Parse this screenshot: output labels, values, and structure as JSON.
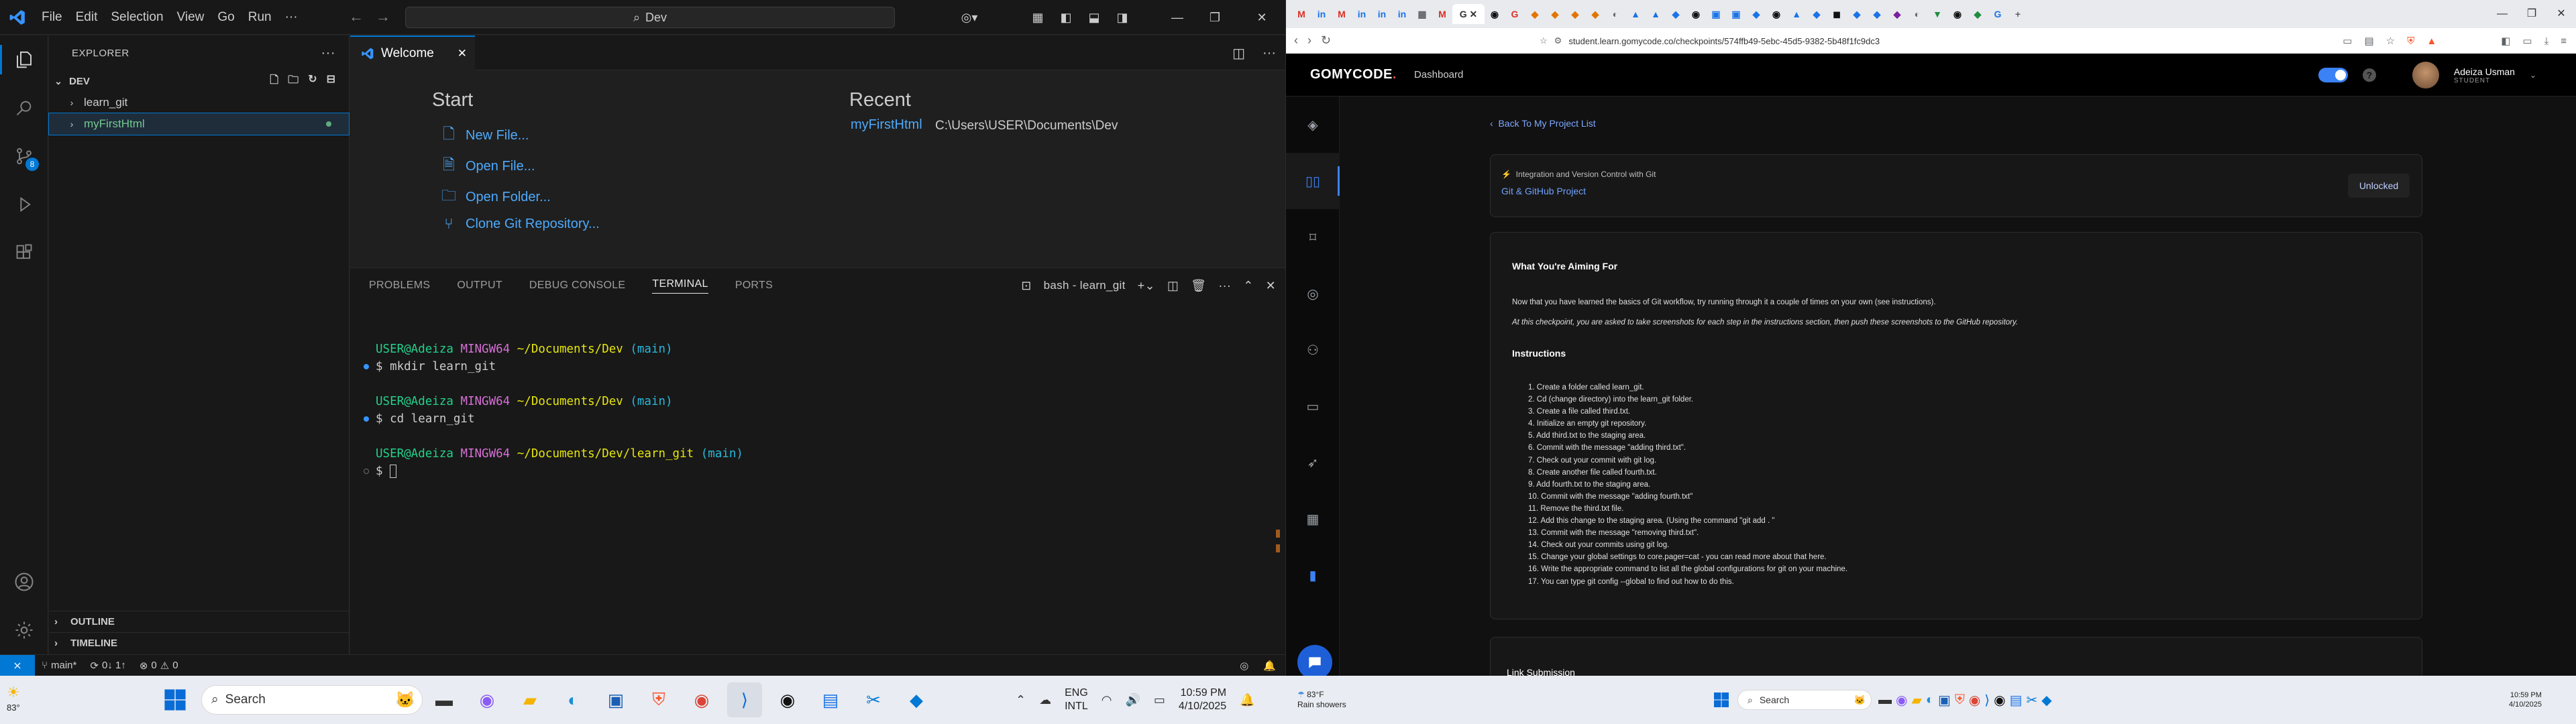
{
  "vscode": {
    "menu": [
      "File",
      "Edit",
      "Selection",
      "View",
      "Go",
      "Run",
      "···"
    ],
    "command_center": "Dev",
    "explorer": {
      "title": "EXPLORER",
      "folder": "DEV",
      "items": [
        "learn_git",
        "myFirstHtml"
      ],
      "outline": "OUTLINE",
      "timeline": "TIMELINE"
    },
    "source_control_badge": "8",
    "tab": "Welcome",
    "welcome": {
      "start_heading": "Start",
      "start_links": [
        "New File...",
        "Open File...",
        "Open Folder...",
        "Clone Git Repository..."
      ],
      "recent_heading": "Recent",
      "recent_name": "myFirstHtml",
      "recent_path": "C:\\Users\\USER\\Documents\\Dev"
    },
    "panel": {
      "tabs": [
        "PROBLEMS",
        "OUTPUT",
        "DEBUG CONSOLE",
        "TERMINAL",
        "PORTS"
      ],
      "terminal_name": "bash - learn_git"
    },
    "terminal": {
      "user": "USER@Adeiza",
      "env": "MINGW64",
      "path1": "~/Documents/Dev",
      "path2": "~/Documents/Dev/learn_git",
      "branch": "(main)",
      "cmd1": "$ mkdir learn_git",
      "cmd2": "$ cd learn_git",
      "prompt": "$ "
    },
    "status": {
      "branch": "main*",
      "sync": "0↓ 1↑",
      "errors": "0",
      "warnings": "0"
    }
  },
  "browser": {
    "url": "student.learn.gomycode.co/checkpoints/574ffb49-5ebc-45d5-9382-5b48f1fc9dc3",
    "brand": "GOMYCODE",
    "nav_dashboard": "Dashboard",
    "user_name": "Adeiza Usman",
    "user_role": "STUDENT",
    "back_link": "Back To My Project List",
    "project_category": "Integration and Version Control with Git",
    "project_title": "Git & GitHub Project",
    "project_status": "Unlocked",
    "aim_heading": "What You're Aiming For",
    "aim_p1": "Now that you have learned the basics of Git workflow, try running through it a couple of times on your own (see instructions).",
    "aim_p2": "At this checkpoint, you are asked to take screenshots for each step in the instructions section, then push these screenshots to the GitHub repository.",
    "instructions_heading": "Instructions",
    "instructions": [
      "1. Create a folder called learn_git.",
      "2. Cd (change directory) into the learn_git folder.",
      "3. Create a file called third.txt.",
      "4. Initialize an empty git repository.",
      "5. Add third.txt to the staging area.",
      "6. Commit with the message \"adding third.txt\".",
      "7. Check out your commit with git log.",
      "8. Create another file called fourth.txt.",
      "9. Add fourth.txt to the staging area.",
      "10. Commit with the message \"adding fourth.txt\"",
      "11. Remove the third.txt file.",
      "12. Add this change to the staging area. (Using the command \"git add . \"",
      "13. Commit with the message \"removing third.txt\".",
      "14. Check out your commits using git log.",
      "15. Change your global settings to core.pager=cat - you can read more about that here.",
      "16. Write the appropriate command to list all the global configurations for git on your machine.",
      "17. You can type git config --global to find out how to do this."
    ],
    "link_submission": "Link Submission"
  },
  "taskbar": {
    "weather_temp": "83°",
    "search_placeholder": "Search",
    "lang1": "ENG",
    "lang2": "INTL",
    "time": "10:59 PM",
    "date": "4/10/2025",
    "right_weather_temp": "83°F",
    "right_weather_desc": "Rain showers",
    "right_search": "Search",
    "right_time": "10:59 PM",
    "right_date": "4/10/2025"
  },
  "colors": {
    "vscode_accent": "#0078d4",
    "link_blue": "#4daafc",
    "git_green": "#73c991",
    "gomycode_blue": "#3b82f6"
  }
}
